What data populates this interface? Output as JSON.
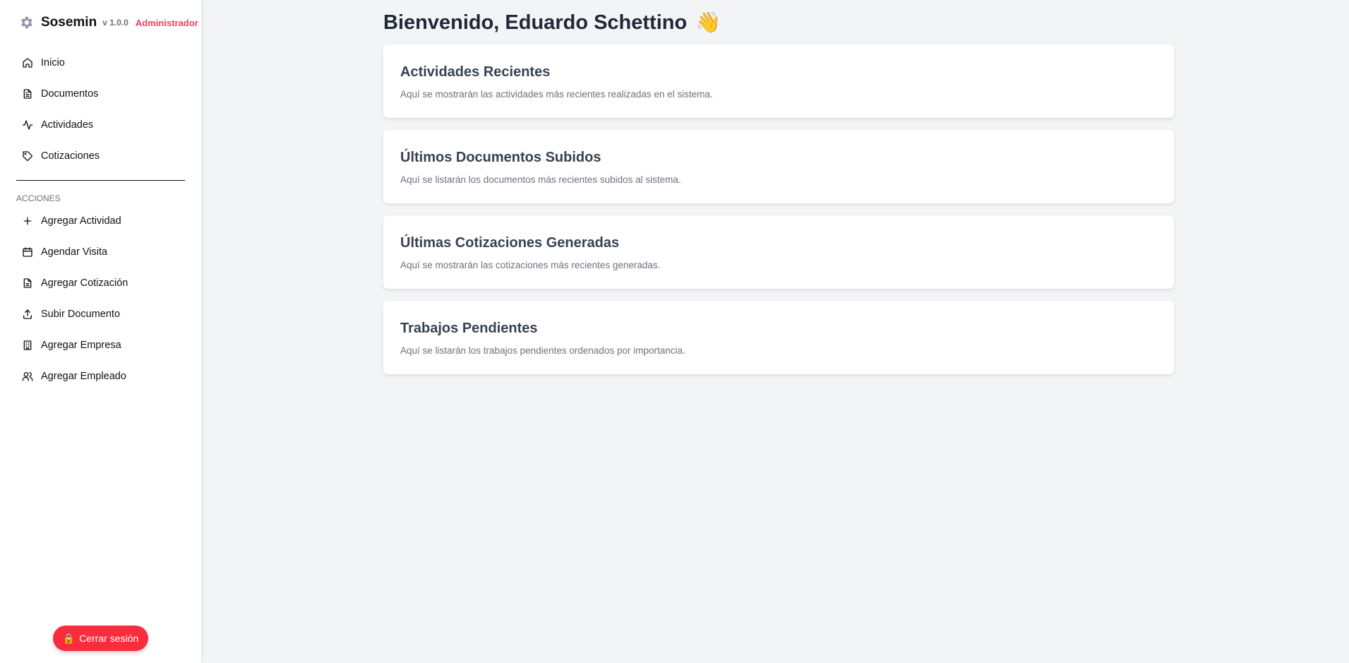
{
  "brand": {
    "name": "Sosemin",
    "version": "v 1.0.0",
    "role": "Administrador"
  },
  "nav": [
    {
      "label": "Inicio",
      "icon": "home-icon"
    },
    {
      "label": "Documentos",
      "icon": "document-icon"
    },
    {
      "label": "Actividades",
      "icon": "activity-icon"
    },
    {
      "label": "Cotizaciones",
      "icon": "tag-icon"
    }
  ],
  "actions_title": "ACCIONES",
  "actions": [
    {
      "label": "Agregar Actividad",
      "icon": "plus-icon"
    },
    {
      "label": "Agendar Visita",
      "icon": "calendar-icon"
    },
    {
      "label": "Agregar Cotización",
      "icon": "document-icon"
    },
    {
      "label": "Subir Documento",
      "icon": "upload-icon"
    },
    {
      "label": "Agregar Empresa",
      "icon": "building-icon"
    },
    {
      "label": "Agregar Empleado",
      "icon": "users-icon"
    }
  ],
  "logout": {
    "icon": "🔒",
    "label": "Cerrar sesión"
  },
  "main": {
    "title": "Bienvenido, Eduardo Schettino",
    "wave": "👋",
    "cards": [
      {
        "title": "Actividades Recientes",
        "text": "Aquí se mostrarán las actividades más recientes realizadas en el sistema."
      },
      {
        "title": "Últimos Documentos Subidos",
        "text": "Aquí se listarán los documentos más recientes subidos al sistema."
      },
      {
        "title": "Últimas Cotizaciones Generadas",
        "text": "Aquí se mostrarán las cotizaciones más recientes generadas."
      },
      {
        "title": "Trabajos Pendientes",
        "text": "Aquí se listarán los trabajos pendientes ordenados por importancia."
      }
    ]
  },
  "colors": {
    "accent": "#fb2c3c",
    "role": "#f43f5e",
    "background": "#f3f4f6"
  }
}
